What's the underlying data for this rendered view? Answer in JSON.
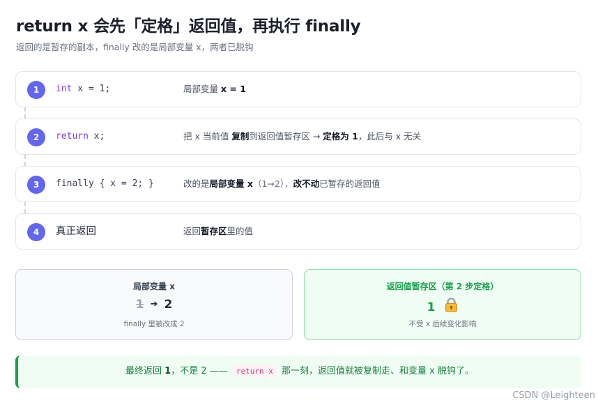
{
  "header": {
    "title": "return x 会先「定格」返回值，再执行 finally",
    "subtitle": "返回的是暂存的副本，finally 改的是局部变量 x，两者已脱钩"
  },
  "steps": [
    {
      "number": "1",
      "code_kw": "int",
      "code_rest": " x = 1;",
      "desc_parts": [
        "局部变量 ",
        "x = 1"
      ]
    },
    {
      "number": "2",
      "code_kw": "return",
      "code_rest": " x;",
      "desc_parts": [
        "把 x 当前值 ",
        "复制",
        "到返回值暂存区 → ",
        "定格为 1",
        "，此后与 x 无关"
      ]
    },
    {
      "number": "3",
      "code_text": "finally { x = 2; }",
      "desc_parts": [
        "改的是",
        "局部变量 x",
        "（1→2），",
        "改不动",
        "已暂存的返回值"
      ]
    },
    {
      "number": "4",
      "label": "真正返回",
      "desc_parts": [
        "返回",
        "暂存区",
        "里的值"
      ]
    }
  ],
  "local_box": {
    "title": "局部变量 x",
    "old_value": "1",
    "arrow": "➔",
    "new_value": "2",
    "note": "finally 里被改成 2"
  },
  "return_box": {
    "title": "返回值暂存区（第 2 步定格）",
    "value": "1",
    "icon": "lock-icon",
    "note": "不受 x 后续变化影响"
  },
  "callout": {
    "part1": "最终返回 ",
    "bold": "1",
    "part2": "，不是 2 —— ",
    "code": "return x",
    "part3": " 那一刻，返回值就被复制走、和变量 x 脱钩了。"
  },
  "watermark": "CSDN @Leighteen",
  "colors": {
    "accent": "#6366f1",
    "success": "#16a34a",
    "keyword": "#7c3aed"
  }
}
